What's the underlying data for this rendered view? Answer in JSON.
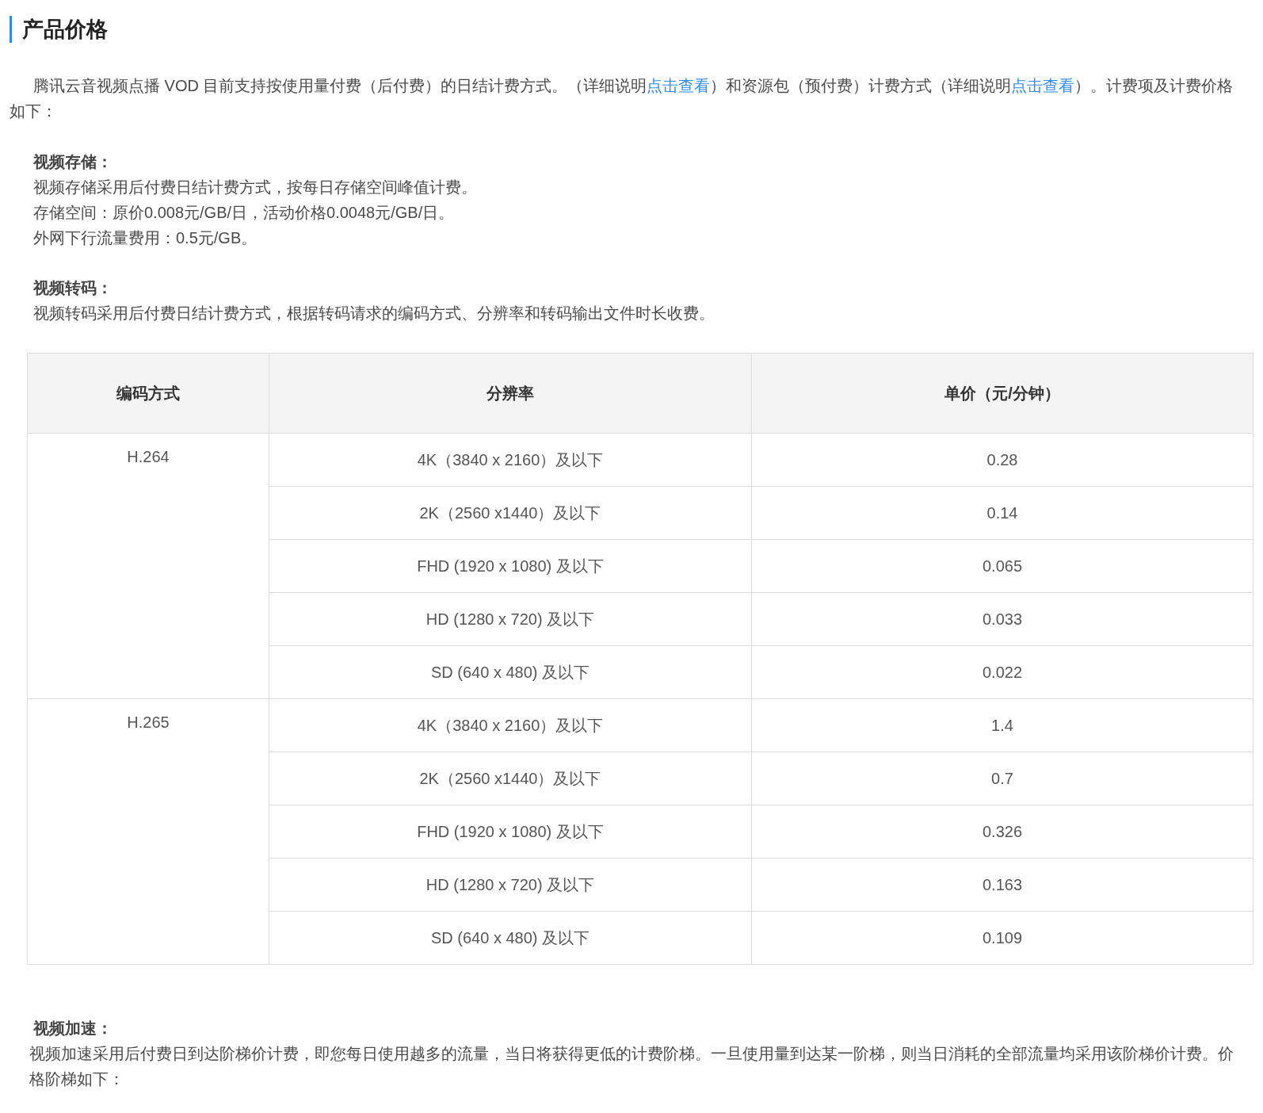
{
  "title": "产品价格",
  "intro": [
    {
      "kind": "text",
      "text": "腾讯云音视频点播 VOD 目前支持按使用量付费（后付费）的日结计费方式。（详细说明"
    },
    {
      "kind": "link",
      "text": "点击查看"
    },
    {
      "kind": "text",
      "text": "）和资源包（预付费）计费方式（详细说明"
    },
    {
      "kind": "link",
      "text": "点击查看"
    },
    {
      "kind": "text",
      "text": "）。计费项及计费价格如下："
    }
  ],
  "storage": {
    "heading": "视频存储：",
    "lines": [
      "视频存储采用后付费日结计费方式，按每日存储空间峰值计费。",
      "存储空间：原价0.008元/GB/日，活动价格0.0048元/GB/日。",
      "外网下行流量费用：0.5元/GB。"
    ]
  },
  "transcode": {
    "heading": "视频转码：",
    "lines": [
      "视频转码采用后付费日结计费方式，根据转码请求的编码方式、分辨率和转码输出文件时长收费。"
    ]
  },
  "table": {
    "columns": [
      "编码方式",
      "分辨率",
      "单价（元/分钟）"
    ],
    "groups": [
      {
        "codec": "H.264",
        "rows": [
          {
            "resolution": "4K（3840 x 2160）及以下",
            "price": "0.28"
          },
          {
            "resolution": "2K（2560 x1440）及以下",
            "price": "0.14"
          },
          {
            "resolution": "FHD (1920 x 1080) 及以下",
            "price": "0.065"
          },
          {
            "resolution": "HD (1280 x 720) 及以下",
            "price": "0.033"
          },
          {
            "resolution": "SD (640 x 480) 及以下",
            "price": "0.022"
          }
        ]
      },
      {
        "codec": "H.265",
        "rows": [
          {
            "resolution": "4K（3840 x 2160）及以下",
            "price": "1.4"
          },
          {
            "resolution": "2K（2560 x1440）及以下",
            "price": "0.7"
          },
          {
            "resolution": "FHD (1920 x 1080) 及以下",
            "price": "0.326"
          },
          {
            "resolution": "HD (1280 x 720) 及以下",
            "price": "0.163"
          },
          {
            "resolution": "SD (640 x 480) 及以下",
            "price": "0.109"
          }
        ]
      }
    ]
  },
  "acceleration": {
    "heading": "视频加速：",
    "text": "视频加速采用后付费日到达阶梯价计费，即您每日使用越多的流量，当日将获得更低的计费阶梯。一旦使用量到达某一阶梯，则当日消耗的全部流量均采用该阶梯价计费。价格阶梯如下："
  }
}
